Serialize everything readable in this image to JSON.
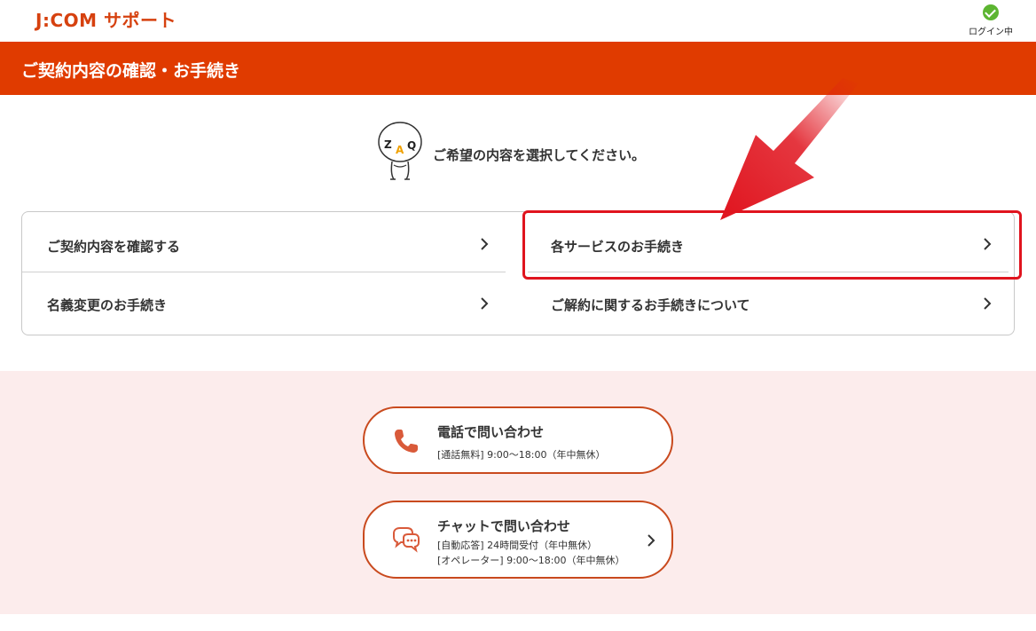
{
  "header": {
    "logo": "J:COM サポート",
    "login_status": "ログイン中"
  },
  "title_bar": {
    "title": "ご契約内容の確認・お手続き"
  },
  "prompt": {
    "text": "ご希望の内容を選択してください。",
    "mascot_letters": [
      "Z",
      "A",
      "Q"
    ]
  },
  "menu": {
    "items": [
      {
        "label": "ご契約内容を確認する"
      },
      {
        "label": "名義変更のお手続き"
      },
      {
        "label": "各サービスのお手続き"
      },
      {
        "label": "ご解約に関するお手続きについて"
      }
    ]
  },
  "contact": {
    "phone": {
      "title": "電話で問い合わせ",
      "sub": "[通話無料] 9:00〜18:00（年中無休）"
    },
    "chat": {
      "title": "チャットで問い合わせ",
      "sub1": "[自動応答] 24時間受付（年中無休）",
      "sub2": "[オペレーター] 9:00〜18:00（年中無休）"
    }
  },
  "colors": {
    "brand": "#e03b00",
    "logo": "#d6410f",
    "login_check": "#5cb531",
    "annotation": "#e0141e",
    "contact_bg": "#fcecec",
    "contact_border": "#c94a1e"
  },
  "icons": {
    "login": "check-circle-icon",
    "menu_chevron": "chevron-right-icon",
    "phone": "phone-icon",
    "chat": "chat-bubbles-icon"
  }
}
